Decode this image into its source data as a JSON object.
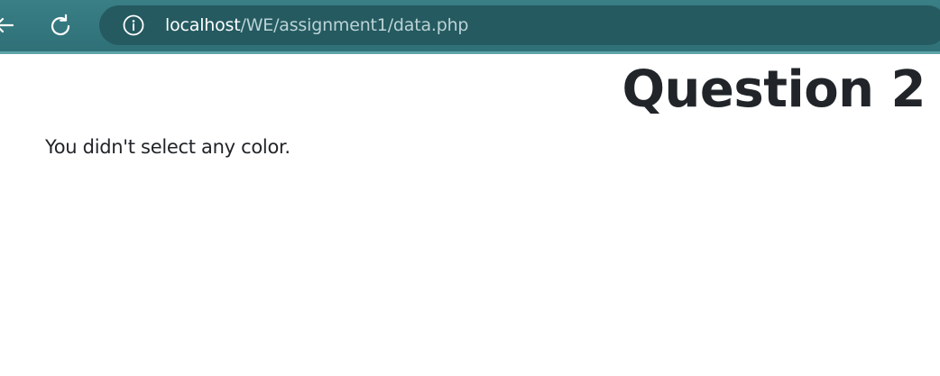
{
  "browser": {
    "url_host": "localhost",
    "url_path": "/WE/assignment1/data.php",
    "icons": {
      "back": "arrow-left-icon",
      "refresh": "refresh-icon",
      "info": "info-icon"
    },
    "colors": {
      "toolbar": "#337479",
      "address_bar": "#245a60",
      "host_text": "#ffffff",
      "path_text": "#bcd3d6"
    }
  },
  "page": {
    "title": "Question 2",
    "message": "You didn't select any color.",
    "text_color": "#212529"
  }
}
